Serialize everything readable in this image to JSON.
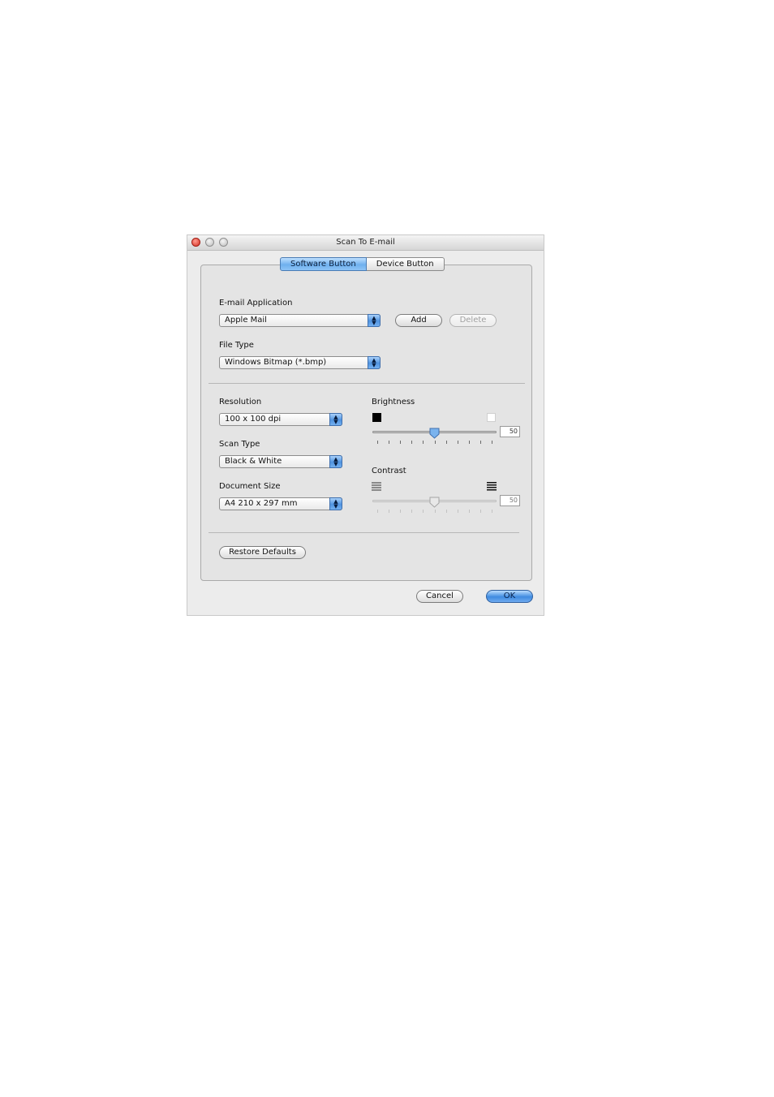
{
  "window": {
    "title": "Scan To E-mail"
  },
  "tabs": [
    {
      "label": "Software Button",
      "active": true
    },
    {
      "label": "Device Button",
      "active": false
    }
  ],
  "email_application": {
    "label": "E-mail Application",
    "value": "Apple Mail",
    "add_label": "Add",
    "delete_label": "Delete"
  },
  "file_type": {
    "label": "File Type",
    "value": "Windows Bitmap (*.bmp)"
  },
  "resolution": {
    "label": "Resolution",
    "value": "100 x 100 dpi"
  },
  "scan_type": {
    "label": "Scan Type",
    "value": "Black & White"
  },
  "document_size": {
    "label": "Document Size",
    "value": "A4 210 x 297 mm"
  },
  "brightness": {
    "label": "Brightness",
    "value": "50",
    "level": 0.5,
    "enabled": true
  },
  "contrast": {
    "label": "Contrast",
    "value": "50",
    "level": 0.5,
    "enabled": false
  },
  "buttons": {
    "restore_defaults": "Restore Defaults",
    "cancel": "Cancel",
    "ok": "OK"
  },
  "colors": {
    "accent": "#4f93e0",
    "close_light": "#d42f22",
    "window_bg": "#ececec"
  }
}
